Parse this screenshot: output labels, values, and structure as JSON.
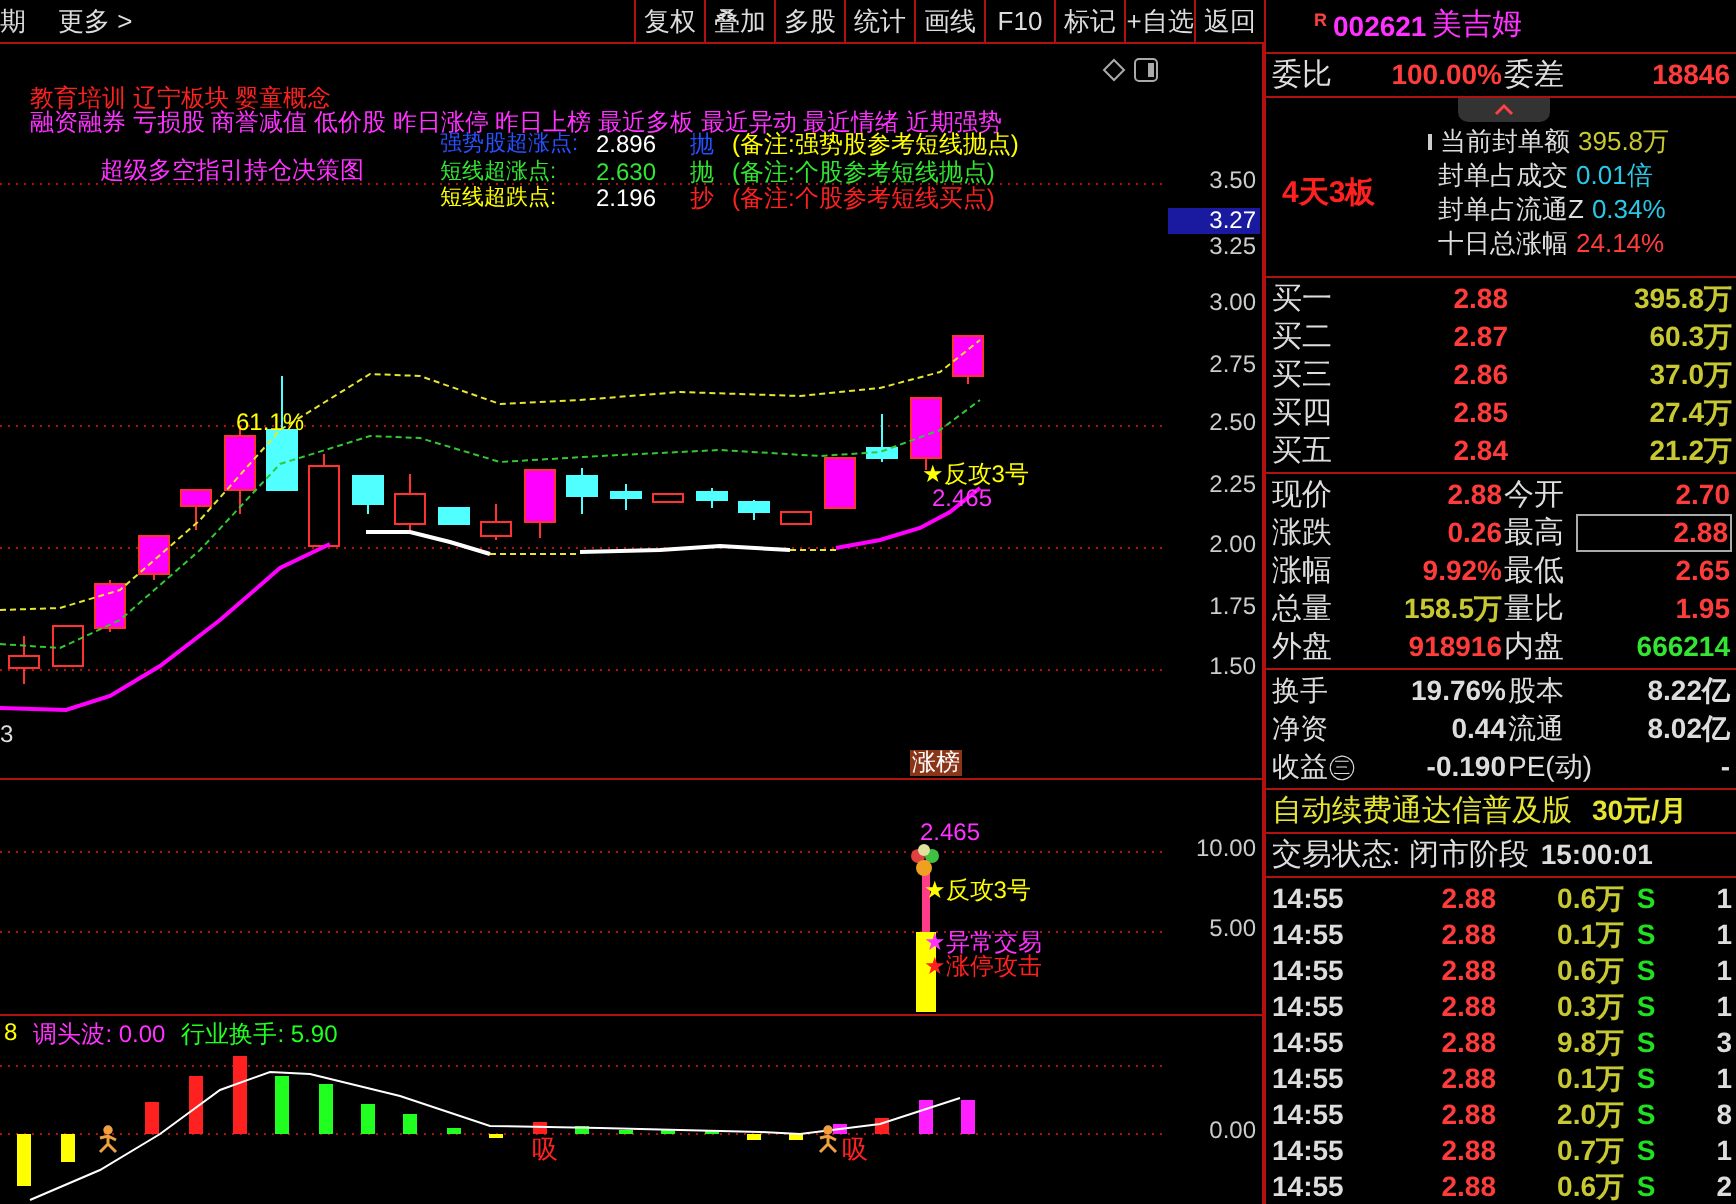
{
  "toolbar": {
    "left": [
      "期",
      "更多 >"
    ],
    "buttons": [
      "复权",
      "叠加",
      "多股",
      "统计",
      "画线",
      "F10",
      "标记",
      "+自选",
      "返回"
    ]
  },
  "main_chart": {
    "tags": "教育培训  辽宁板块  婴童概念",
    "concepts": "融资融券 亏损股 商誉减值 低价股 昨日涨停 昨日上榜 最近多板 最近异动 最近情绪 近期强势",
    "title": "超级多空指引持仓决策图",
    "signals": [
      {
        "kind": "strong-sell",
        "label": "强势股超涨点:",
        "value": "2.896",
        "action": "抛",
        "note": "(备注:强势股参考短线抛点)"
      },
      {
        "kind": "sell",
        "label": "短线超涨点:",
        "value": "2.630",
        "action": "抛",
        "note": "(备注:个股参考短线抛点)"
      },
      {
        "kind": "buy",
        "label": "短线超跌点:",
        "value": "2.196",
        "action": "抄",
        "note": "(备注:个股参考短线买点)"
      }
    ],
    "price_axis": [
      "3.50",
      "3.25",
      "3.00",
      "2.75",
      "2.50",
      "2.25",
      "2.00",
      "1.75",
      "1.50"
    ],
    "current_price": "3.27",
    "peak_label": "61.1%",
    "attack_label": "★反攻3号",
    "band_value": "2.465",
    "left_value": "3",
    "limit_tag": "涨榜"
  },
  "volume_panel": {
    "axis": [
      "10.00",
      "5.00"
    ],
    "value": "2.465",
    "signals": [
      {
        "kind": "attack",
        "text": "★反攻3号"
      },
      {
        "kind": "abnormal",
        "text": "★异常交易"
      },
      {
        "kind": "limit",
        "text": "★涨停攻击"
      }
    ]
  },
  "indicator_panel": {
    "header": [
      {
        "kind": "period",
        "text": "8"
      },
      {
        "kind": "wave",
        "text": "调头波: 0.00"
      },
      {
        "kind": "industry",
        "text": "行业换手: 5.90"
      }
    ],
    "axis": [
      "0.00"
    ],
    "marks": [
      "吸",
      "吸"
    ]
  },
  "quote": {
    "badge": "R",
    "code": "002621",
    "name": "美吉姆",
    "order_ratio": {
      "label": "委比",
      "value": "100.00%",
      "diff_label": "委差",
      "diff_value": "18846"
    },
    "streak": "4天3板",
    "seal_info": [
      {
        "label": "当前封单额",
        "value": "395.8万",
        "color": "#c8c832"
      },
      {
        "label": "封单占成交",
        "value": "0.01倍",
        "color": "#28c8e6"
      },
      {
        "label": "封单占流通Z",
        "value": "0.34%",
        "color": "#28c8e6"
      },
      {
        "label": "十日总涨幅",
        "value": "24.14%",
        "color": "#ff3c3c"
      }
    ],
    "bids": [
      {
        "label": "买一",
        "price": "2.88",
        "volume": "395.8万"
      },
      {
        "label": "买二",
        "price": "2.87",
        "volume": "60.3万"
      },
      {
        "label": "买三",
        "price": "2.86",
        "volume": "37.0万"
      },
      {
        "label": "买四",
        "price": "2.85",
        "volume": "27.4万"
      },
      {
        "label": "买五",
        "price": "2.84",
        "volume": "21.2万"
      }
    ],
    "stats": [
      [
        {
          "label": "现价",
          "value": "2.88",
          "color": "#ff3c3c",
          "boxed": false
        },
        {
          "label": "今开",
          "value": "2.70",
          "color": "#ff3c3c",
          "boxed": false
        }
      ],
      [
        {
          "label": "涨跌",
          "value": "0.26",
          "color": "#ff3c3c",
          "boxed": false
        },
        {
          "label": "最高",
          "value": "2.88",
          "color": "#ff3c3c",
          "boxed": true
        }
      ],
      [
        {
          "label": "涨幅",
          "value": "9.92%",
          "color": "#ff3c3c",
          "boxed": false
        },
        {
          "label": "最低",
          "value": "2.65",
          "color": "#ff3c3c",
          "boxed": false
        }
      ],
      [
        {
          "label": "总量",
          "value": "158.5万",
          "color": "#c8c832",
          "boxed": false
        },
        {
          "label": "量比",
          "value": "1.95",
          "color": "#ff3c3c",
          "boxed": false
        }
      ],
      [
        {
          "label": "外盘",
          "value": "918916",
          "color": "#ff3c3c",
          "boxed": false
        },
        {
          "label": "内盘",
          "value": "666214",
          "color": "#32e632",
          "boxed": false
        }
      ]
    ],
    "fundamentals": [
      [
        {
          "label": "换手",
          "value": "19.76%"
        },
        {
          "label": "股本",
          "value": "8.22亿"
        }
      ],
      [
        {
          "label": "净资",
          "value": "0.44"
        },
        {
          "label": "流通",
          "value": "8.02亿"
        }
      ],
      [
        {
          "label": "收益㊂",
          "value": "-0.190"
        },
        {
          "label": "PE(动)",
          "value": "-"
        }
      ]
    ],
    "promo": {
      "text": "自动续费通达信普及版",
      "price": "30元/月"
    },
    "status": {
      "text": "交易状态: 闭市阶段",
      "time": "15:00:01"
    },
    "ticks": [
      {
        "time": "14:55",
        "price": "2.88",
        "volume": "0.6万",
        "side": "S",
        "count": "1"
      },
      {
        "time": "14:55",
        "price": "2.88",
        "volume": "0.1万",
        "side": "S",
        "count": "1"
      },
      {
        "time": "14:55",
        "price": "2.88",
        "volume": "0.6万",
        "side": "S",
        "count": "1"
      },
      {
        "time": "14:55",
        "price": "2.88",
        "volume": "0.3万",
        "side": "S",
        "count": "1"
      },
      {
        "time": "14:55",
        "price": "2.88",
        "volume": "9.8万",
        "side": "S",
        "count": "3"
      },
      {
        "time": "14:55",
        "price": "2.88",
        "volume": "0.1万",
        "side": "S",
        "count": "1"
      },
      {
        "time": "14:55",
        "price": "2.88",
        "volume": "2.0万",
        "side": "S",
        "count": "8"
      },
      {
        "time": "14:55",
        "price": "2.88",
        "volume": "0.7万",
        "side": "S",
        "count": "1"
      },
      {
        "time": "14:55",
        "price": "2.88",
        "volume": "0.6万",
        "side": "S",
        "count": "2"
      }
    ]
  }
}
